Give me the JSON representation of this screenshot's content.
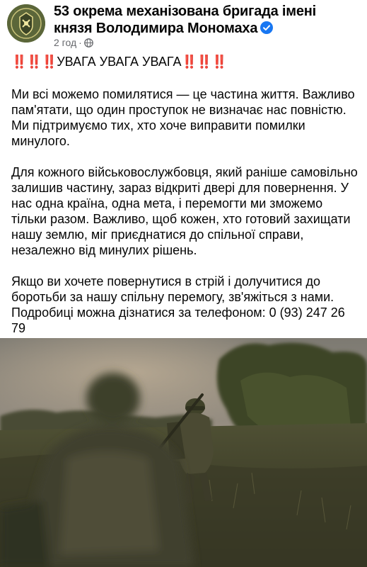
{
  "header": {
    "page_name": "53 окрема механізована бригада імені князя Володимира Мономаха",
    "timestamp": "2 год",
    "separator": "·",
    "verified_icon": "verified-badge-icon",
    "privacy_icon": "globe-icon"
  },
  "post": {
    "headline_marks": "‼️‼️‼️",
    "headline_text": "УВАГА УВАГА УВАГА",
    "headline_marks_end": "‼️‼️‼️",
    "paragraphs": [
      "Ми всі можемо помилятися — це частина життя. Важливо пам'ятати, що один проступок не визначає нас повністю. Ми підтримуємо тих, хто хоче виправити помилки минулого.",
      "Для кожного військовослужбовця, який раніше самовільно залишив частину, зараз відкриті двері для повернення. У нас одна країна, одна мета, і перемогти ми зможемо тільки разом. Важливо, щоб кожен, хто готовий захищати нашу землю, міг приєднатися до спільної справи, незалежно від минулих рішень.",
      "Якщо ви хочете повернутися в стрій і долучитися до боротьби за нашу спільну перемогу, зв'яжіться з нами. Подробиці можна дізнатися за телефоном: 0 (93) 247 26 79"
    ]
  },
  "colors": {
    "text": "#050505",
    "meta": "#65676b",
    "verified": "#1877f2",
    "alert": "#e0242f"
  }
}
